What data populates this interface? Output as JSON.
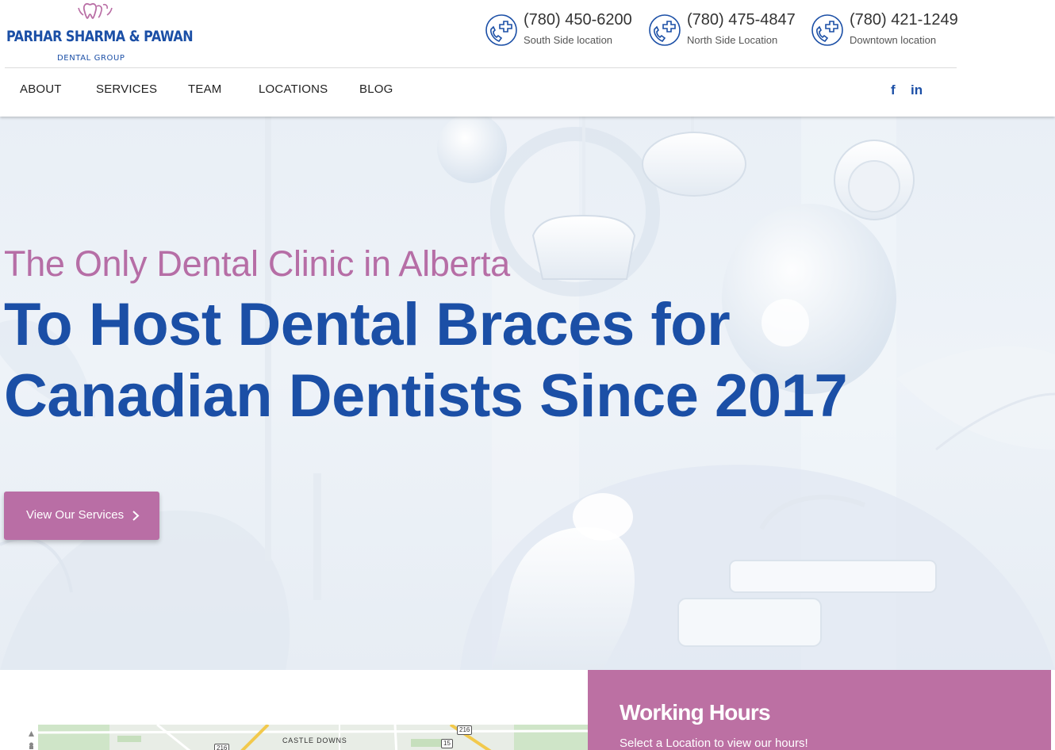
{
  "brand": {
    "name": "PARHAR SHARMA & PAWAN",
    "tagline": "DENTAL GROUP",
    "primary_color": "#1b4fa6",
    "accent_color": "#b96ea5",
    "logo_icon": "tooth-logo-icon"
  },
  "phones": [
    {
      "number": "(780) 450-6200",
      "location": "South Side location",
      "icon": "phone-plus-icon"
    },
    {
      "number": "(780) 475-4847",
      "location": "North Side Location",
      "icon": "phone-plus-icon"
    },
    {
      "number": "(780) 421-1249",
      "location": "Downtown location",
      "icon": "phone-plus-icon"
    }
  ],
  "nav": {
    "items": [
      "ABOUT",
      "SERVICES",
      "TEAM",
      "LOCATIONS",
      "BLOG"
    ],
    "social": [
      {
        "label": "f",
        "icon": "facebook-icon"
      },
      {
        "label": "in",
        "icon": "linkedin-icon"
      }
    ]
  },
  "hero": {
    "eyebrow": "The Only Dental Clinic in Alberta",
    "title_line1": "To Host Dental Braces for",
    "title_line2": "Canadian Dentists Since 2017",
    "cta_label": "View Our Services",
    "cta_icon": "chevron-right-icon"
  },
  "map": {
    "label": "CASTLE DOWNS",
    "shields": [
      "216",
      "216",
      "15"
    ]
  },
  "hours": {
    "title": "Working Hours",
    "subtitle": "Select a Location to view our hours!"
  }
}
